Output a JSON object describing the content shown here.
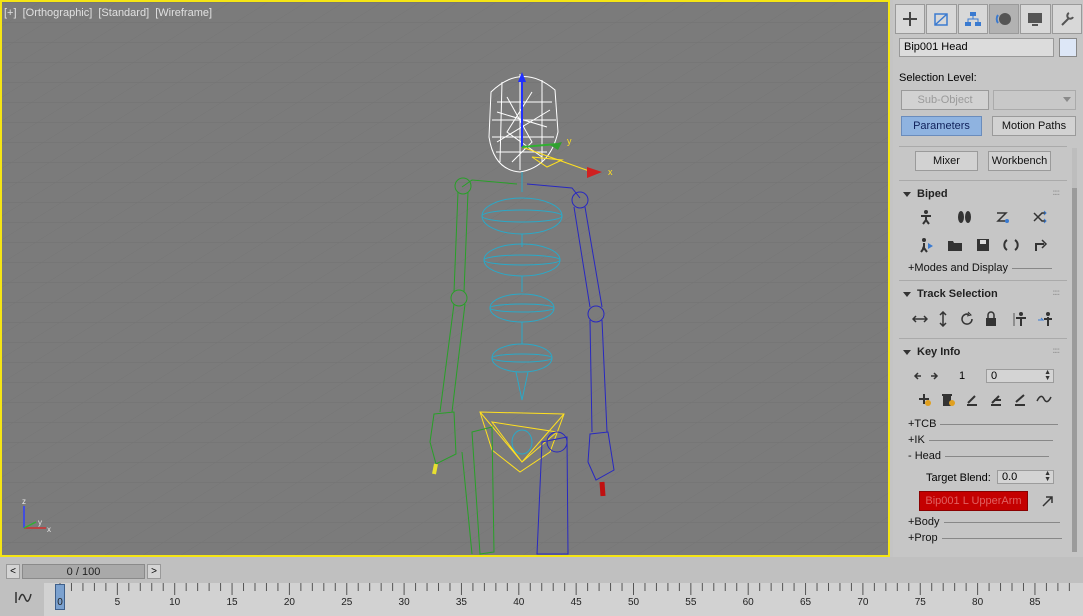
{
  "viewport": {
    "labels": [
      "[+]",
      "[Orthographic]",
      "[Standard]",
      "[Wireframe]"
    ],
    "axis_labels": {
      "z": "z",
      "y": "y",
      "x": "x"
    }
  },
  "command_panel": {
    "tabs": [
      "create",
      "modify",
      "hierarchy",
      "motion",
      "display",
      "utilities"
    ],
    "object_name": "Bip001 Head",
    "selection_level_label": "Selection Level:",
    "sub_object_label": "Sub-Object",
    "parameters_label": "Parameters",
    "motion_paths_label": "Motion Paths",
    "mixer_label": "Mixer",
    "workbench_label": "Workbench",
    "biped": {
      "title": "Biped",
      "modes_display": "+Modes and Display"
    },
    "track_selection": {
      "title": "Track Selection"
    },
    "key_info": {
      "title": "Key Info",
      "key_number": "1",
      "key_time": "0",
      "tcb": "+TCB",
      "ik": "+IK",
      "head": "- Head",
      "target_blend_label": "Target Blend:",
      "target_blend_value": "0.0",
      "target_object": "Bip001 L UpperArm",
      "body": "+Body",
      "prop": "+Prop"
    }
  },
  "timeline": {
    "prev": "<",
    "frame_display": "0 / 100",
    "next": ">",
    "ticks": [
      "0",
      "5",
      "10",
      "15",
      "20",
      "25",
      "30",
      "35",
      "40",
      "45",
      "50",
      "55",
      "60",
      "65",
      "70",
      "75",
      "80",
      "85"
    ]
  }
}
